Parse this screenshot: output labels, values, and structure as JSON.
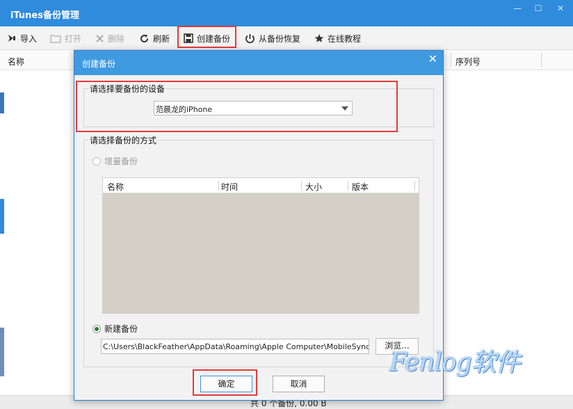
{
  "window": {
    "title": "iTunes备份管理",
    "minimize": "—",
    "maximize": "☐",
    "close": "✕"
  },
  "toolbar": {
    "import": "导入",
    "open": "打开",
    "delete": "删除",
    "refresh": "刷新",
    "create": "创建备份",
    "restore": "从备份恢复",
    "tutorial": "在线教程"
  },
  "list": {
    "columns": [
      "名称",
      "序列号"
    ]
  },
  "status": {
    "text": "共 0 个备份, 0.00 B"
  },
  "dialog": {
    "title": "创建备份",
    "close": "✕",
    "device_group": "请选择要备份的设备",
    "device_value": "范晨龙的iPhone",
    "mode_group": "请选择备份的方式",
    "incremental": "增量备份",
    "table_columns": [
      "名称",
      "时间",
      "大小",
      "版本"
    ],
    "new_backup": "新建备份",
    "path": "C:\\Users\\BlackFeather\\AppData\\Roaming\\Apple Computer\\MobileSync\\Backup",
    "browse": "浏览...",
    "ok": "确定",
    "cancel": "取消"
  },
  "watermark": {
    "text": "Fenlog软件"
  },
  "colors": {
    "title_bar": "#2f8bdc",
    "dialog_title": "#409ae0",
    "highlight": "#e23a3a"
  }
}
